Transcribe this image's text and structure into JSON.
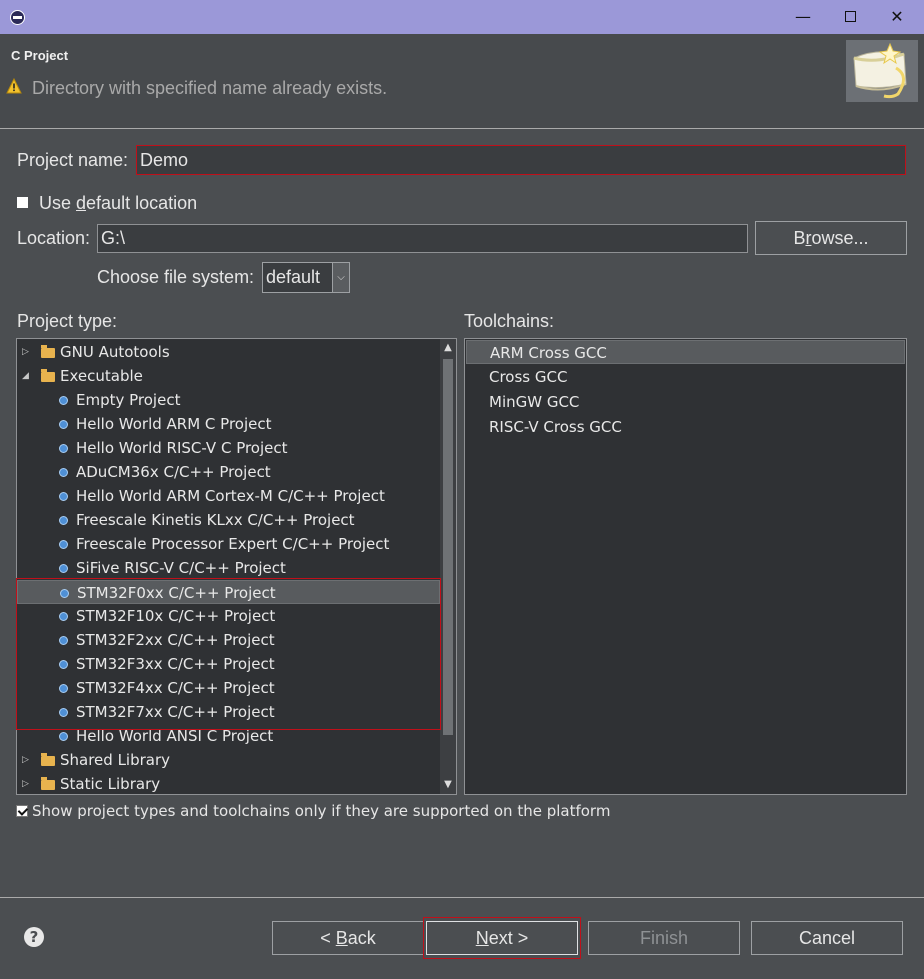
{
  "window": {
    "minimize_glyph": "—",
    "close_glyph": "✕"
  },
  "header": {
    "title": "C Project",
    "message": "Directory with specified name already exists.",
    "message_icon": "warning-icon"
  },
  "form": {
    "project_name_label": "Project name:",
    "project_name_value": "Demo",
    "use_default_location_label_pre": "Use ",
    "use_default_location_label_ul": "d",
    "use_default_location_label_post": "efault location",
    "use_default_location_checked": false,
    "location_label": "Location:",
    "location_value": "G:\\",
    "browse_pre": "B",
    "browse_ul": "r",
    "browse_post": "owse...",
    "file_system_label": "Choose file system:",
    "file_system_value": "default"
  },
  "project_type": {
    "label": "Project type:",
    "items": [
      {
        "label": "GNU Autotools",
        "kind": "folder",
        "expanded": false
      },
      {
        "label": "Executable",
        "kind": "folder",
        "expanded": true
      },
      {
        "label": "Empty Project",
        "kind": "item"
      },
      {
        "label": "Hello World ARM C Project",
        "kind": "item"
      },
      {
        "label": "Hello World RISC-V C Project",
        "kind": "item"
      },
      {
        "label": "ADuCM36x C/C++ Project",
        "kind": "item"
      },
      {
        "label": "Hello World ARM Cortex-M C/C++ Project",
        "kind": "item"
      },
      {
        "label": "Freescale Kinetis KLxx C/C++ Project",
        "kind": "item"
      },
      {
        "label": "Freescale Processor Expert C/C++ Project",
        "kind": "item"
      },
      {
        "label": "SiFive RISC-V C/C++ Project",
        "kind": "item"
      },
      {
        "label": "STM32F0xx C/C++ Project",
        "kind": "item",
        "selected": true
      },
      {
        "label": "STM32F10x C/C++ Project",
        "kind": "item"
      },
      {
        "label": "STM32F2xx C/C++ Project",
        "kind": "item"
      },
      {
        "label": "STM32F3xx C/C++ Project",
        "kind": "item"
      },
      {
        "label": "STM32F4xx C/C++ Project",
        "kind": "item"
      },
      {
        "label": "STM32F7xx C/C++ Project",
        "kind": "item"
      },
      {
        "label": "Hello World ANSI C Project",
        "kind": "item"
      },
      {
        "label": "Shared Library",
        "kind": "folder",
        "expanded": false
      },
      {
        "label": "Static Library",
        "kind": "folder",
        "expanded": false
      }
    ]
  },
  "toolchains": {
    "label": "Toolchains:",
    "items": [
      {
        "label": "ARM Cross GCC",
        "selected": true
      },
      {
        "label": "Cross GCC"
      },
      {
        "label": "MinGW GCC"
      },
      {
        "label": "RISC-V Cross GCC"
      }
    ]
  },
  "filter": {
    "label": "Show project types and toolchains only if they are supported on the platform",
    "checked": true
  },
  "buttons": {
    "help_glyph": "?",
    "back_pre": "< ",
    "back_ul": "B",
    "back_post": "ack",
    "next_ul": "N",
    "next_post": "ext >",
    "finish": "Finish",
    "cancel": "Cancel"
  },
  "colors": {
    "titlebar": "#9b98d8",
    "background": "#4b4e51",
    "list_background": "#2f3134",
    "highlight_red": "#c0101a",
    "folder": "#e8b34e",
    "item_bullet": "#4f90d6"
  }
}
